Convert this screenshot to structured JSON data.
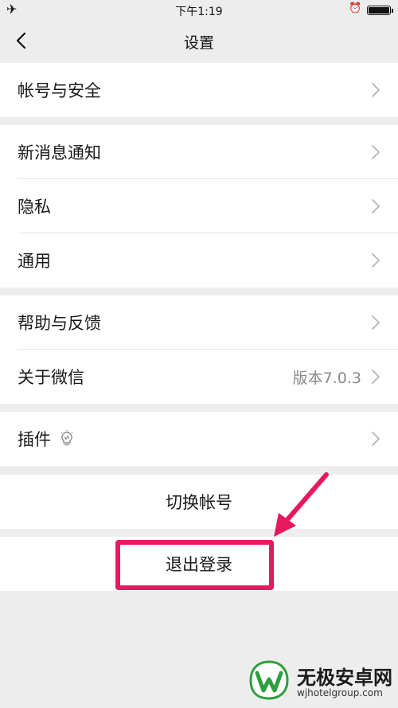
{
  "status_bar": {
    "time": "下午1:19",
    "airplane_icon": "airplane-icon",
    "alarm_icon": "alarm-icon",
    "battery_level": 1.0
  },
  "nav": {
    "title": "设置",
    "back_icon": "chevron-left-icon"
  },
  "groups": [
    {
      "items": [
        {
          "label": "帐号与安全"
        }
      ]
    },
    {
      "items": [
        {
          "label": "新消息通知"
        },
        {
          "label": "隐私"
        },
        {
          "label": "通用"
        }
      ]
    },
    {
      "items": [
        {
          "label": "帮助与反馈"
        },
        {
          "label": "关于微信",
          "value": "版本7.0.3"
        }
      ]
    },
    {
      "items": [
        {
          "label": "插件",
          "icon": "lightbulb-icon"
        }
      ]
    }
  ],
  "switch_account": "切换帐号",
  "logout": "退出登录",
  "annotation": {
    "highlight_color": "#e8185e"
  },
  "watermark": {
    "name": "无极安卓网",
    "url": "wjhotelgroup.com"
  },
  "colors": {
    "background": "#ededed",
    "card": "#ffffff",
    "secondary_text": "#8a8a8a"
  }
}
